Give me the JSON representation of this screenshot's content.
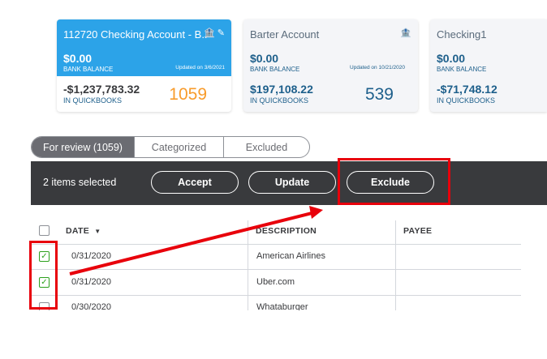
{
  "cards": [
    {
      "name": "112720 Checking Account - B..",
      "bank_amount": "$0.00",
      "bank_label": "BANK BALANCE",
      "updated": "Updated on 3/6/2021",
      "qb_amount": "-$1,237,783.32",
      "qb_label": "IN QUICKBOOKS",
      "count": "1059",
      "icons": "bank-icon pencil-icon"
    },
    {
      "name": "Barter Account",
      "bank_amount": "$0.00",
      "bank_label": "BANK BALANCE",
      "updated": "Updated on 10/21/2020",
      "qb_amount": "$197,108.22",
      "qb_label": "IN QUICKBOOKS",
      "count": "539",
      "icons": "bank-icon"
    },
    {
      "name": "Checking1",
      "bank_amount": "$0.00",
      "bank_label": "BANK BALANCE",
      "updated": "",
      "qb_amount": "-$71,748.12",
      "qb_label": "IN QUICKBOOKS",
      "count": "",
      "icons": ""
    }
  ],
  "tabs": [
    "For review (1059)",
    "Categorized",
    "Excluded"
  ],
  "action_bar": {
    "selected_text": "2 items selected",
    "accept": "Accept",
    "update": "Update",
    "exclude": "Exclude"
  },
  "table": {
    "headers": {
      "date": "DATE",
      "sort_icon": "▼",
      "description": "DESCRIPTION",
      "payee": "PAYEE"
    },
    "rows": [
      {
        "date": "0/31/2020",
        "description": "American Airlines",
        "checked": true
      },
      {
        "date": "0/31/2020",
        "description": "Uber.com",
        "checked": true
      },
      {
        "date": "0/30/2020",
        "description": "Whataburger",
        "checked": false
      }
    ]
  },
  "colors": {
    "accent": "#2ca3e8",
    "count_highlight": "#f89c2c",
    "annotation": "#e8000b",
    "bar": "#393a3d"
  }
}
